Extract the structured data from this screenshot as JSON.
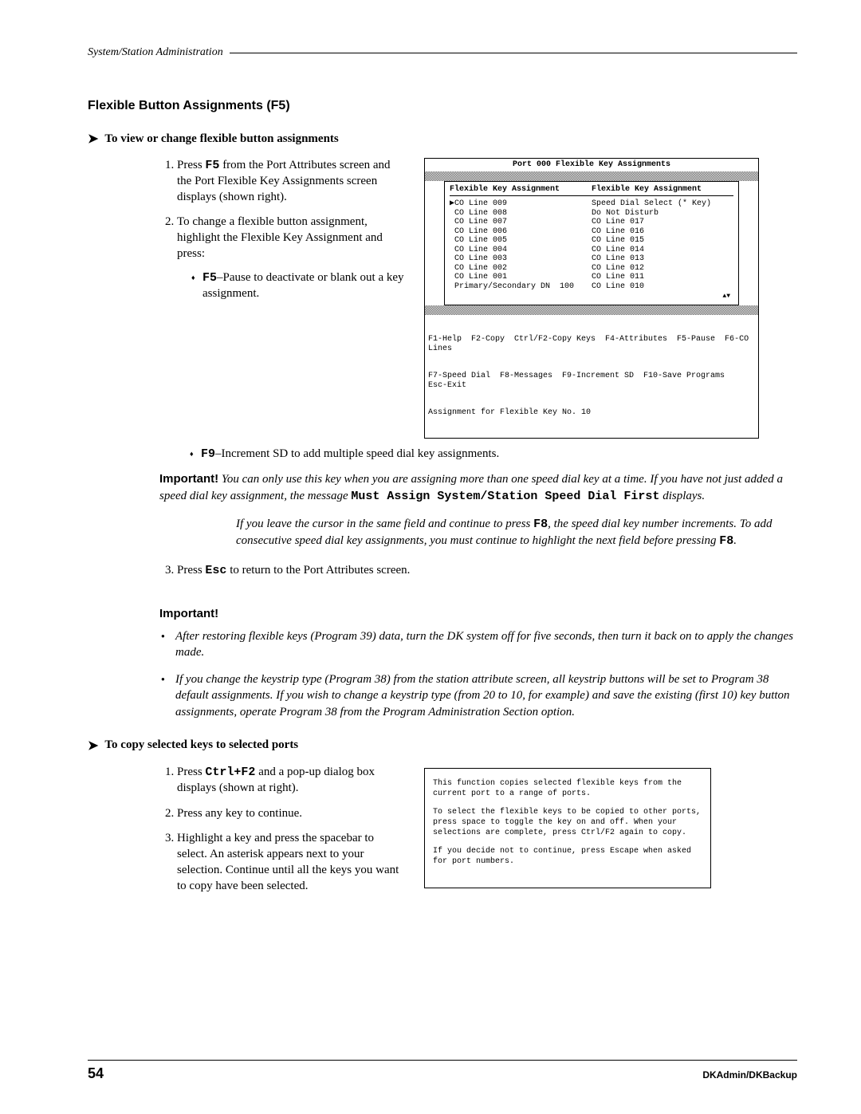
{
  "header": {
    "breadcrumb": "System/Station Administration"
  },
  "section_title": "Flexible Button Assignments (F5)",
  "proc1": {
    "heading": "To view or change flexible button assignments",
    "step1_a": "Press ",
    "step1_key": "F5",
    "step1_b": " from the Port Attributes screen and the Port Flexible Key Assignments screen displays (shown right).",
    "step2": "To change a flexible button assignment, highlight the Flexible Key Assignment and press:",
    "sub1_key": "F5",
    "sub1_txt": "–Pause to deactivate or blank out a key assignment.",
    "sub2_key": "F9",
    "sub2_txt": "–Increment SD to add multiple speed dial key assignments."
  },
  "important1": {
    "label": "Important!",
    "line1_a": "You can only use this key when you are assigning more than one speed dial key at a time. If you have not just added a speed dial key assignment, the message ",
    "line1_code": "Must Assign System/Station Speed Dial First",
    "line1_b": " displays.",
    "para2_a": "If you leave the cursor in the same field and continue to press ",
    "para2_key": "F8",
    "para2_b": ", the speed dial key number increments. To add consecutive speed dial key assignments, you must continue to highlight the next field before pressing ",
    "para2_key2": "F8",
    "para2_c": "."
  },
  "step3_a": "Press ",
  "step3_key": "Esc",
  "step3_b": " to return to the Port Attributes screen.",
  "important2": {
    "label": "Important!",
    "b1": "After restoring flexible keys (Program 39) data, turn the DK system off for five seconds, then turn it back on to apply the changes made.",
    "b2": "If you change the keystrip type (Program 38) from the station attribute screen, all keystrip buttons will be set to Program 38 default assignments. If you wish to change a keystrip type (from 20 to 10, for example) and save the existing (first 10) key button assignments, operate Program 38 from the Program Administration Section option."
  },
  "proc2": {
    "heading": "To copy selected keys to selected ports",
    "step1_a": "Press ",
    "step1_key": "Ctrl+F2",
    "step1_b": " and a pop-up dialog box displays (shown at right).",
    "step2": "Press any key to continue.",
    "step3": "Highlight a key and press the spacebar to select. An asterisk appears next to your selection. Continue until all the keys you want to copy have been selected."
  },
  "shot1": {
    "title": "Port 000  Flexible Key Assignments",
    "colhead_l": "Flexible Key Assignment",
    "colhead_r": "Flexible Key Assignment",
    "left": [
      "▶CO Line 009",
      " CO Line 008",
      " CO Line 007",
      " CO Line 006",
      " CO Line 005",
      " CO Line 004",
      " CO Line 003",
      " CO Line 002",
      " CO Line 001",
      " Primary/Secondary DN  100"
    ],
    "right": [
      "Speed Dial Select (* Key)",
      "Do Not Disturb",
      "CO Line 017",
      "CO Line 016",
      "CO Line 015",
      "CO Line 014",
      "CO Line 013",
      "CO Line 012",
      "CO Line 011",
      "CO Line 010"
    ],
    "scroll": "▲▼",
    "fkeys1": "F1-Help  F2-Copy  Ctrl/F2-Copy Keys  F4-Attributes  F5-Pause  F6-CO Lines",
    "fkeys2": "F7-Speed Dial  F8-Messages  F9-Increment SD  F10-Save Programs          Esc-Exit",
    "fkeys3": "Assignment for Flexible Key No. 10"
  },
  "shot2": {
    "p1": "This function copies selected flexible keys from the current port to a range of ports.",
    "p2": "To select the flexible keys to be copied to other ports, press space to toggle the key on and off.  When your selections are complete, press Ctrl/F2 again to copy.",
    "p3": "If you decide not to continue, press Escape when asked for port numbers."
  },
  "footer": {
    "page": "54",
    "doc": "DKAdmin/DKBackup"
  }
}
